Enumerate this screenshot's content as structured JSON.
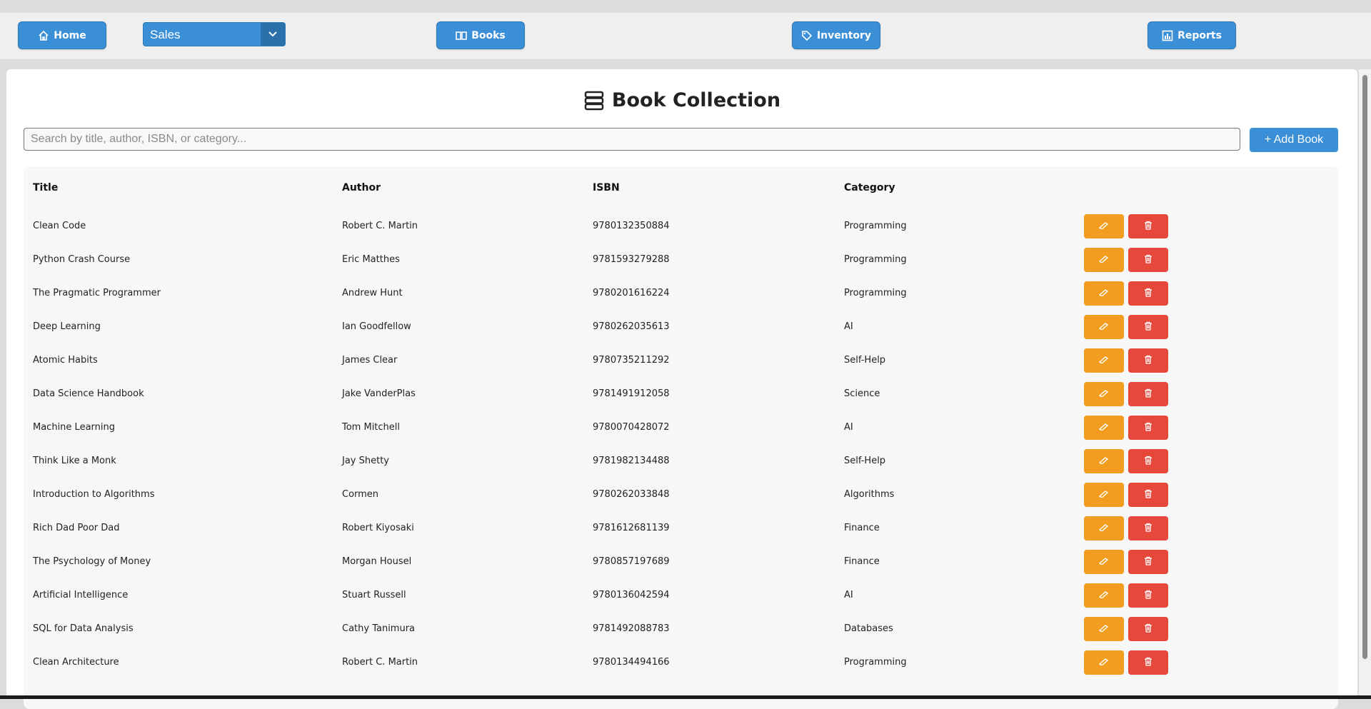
{
  "nav": {
    "home": "Home",
    "books": "Books",
    "inventory": "Inventory",
    "reports": "Reports",
    "sales_select": "Sales"
  },
  "page": {
    "title": "Book Collection",
    "search_placeholder": "Search by title, author, ISBN, or category...",
    "add_button": "+ Add Book"
  },
  "table": {
    "headers": [
      "Title",
      "Author",
      "ISBN",
      "Category"
    ],
    "rows": [
      [
        "Clean Code",
        "Robert C. Martin",
        "9780132350884",
        "Programming"
      ],
      [
        "Python Crash Course",
        "Eric Matthes",
        "9781593279288",
        "Programming"
      ],
      [
        "The Pragmatic Programmer",
        "Andrew Hunt",
        "9780201616224",
        "Programming"
      ],
      [
        "Deep Learning",
        "Ian Goodfellow",
        "9780262035613",
        "AI"
      ],
      [
        "Atomic Habits",
        "James Clear",
        "9780735211292",
        "Self-Help"
      ],
      [
        "Data Science Handbook",
        "Jake VanderPlas",
        "9781491912058",
        "Science"
      ],
      [
        "Machine Learning",
        "Tom Mitchell",
        "9780070428072",
        "AI"
      ],
      [
        "Think Like a Monk",
        "Jay Shetty",
        "9781982134488",
        "Self-Help"
      ],
      [
        "Introduction to Algorithms",
        "Cormen",
        "9780262033848",
        "Algorithms"
      ],
      [
        "Rich Dad Poor Dad",
        "Robert Kiyosaki",
        "9781612681139",
        "Finance"
      ],
      [
        "The Psychology of Money",
        "Morgan Housel",
        "9780857197689",
        "Finance"
      ],
      [
        "Artificial Intelligence",
        "Stuart Russell",
        "9780136042594",
        "AI"
      ],
      [
        "SQL for Data Analysis",
        "Cathy Tanimura",
        "9781492088783",
        "Databases"
      ],
      [
        "Clean Architecture",
        "Robert C. Martin",
        "9780134494166",
        "Programming"
      ]
    ]
  },
  "colors": {
    "primary": "#3a8fd6",
    "edit": "#f29d1f",
    "delete": "#e6483c"
  },
  "icons": {
    "home": "home-icon",
    "books": "book-open-icon",
    "inventory": "tag-icon",
    "reports": "bar-chart-icon",
    "title": "books-stack-icon",
    "edit": "pencil-icon",
    "delete": "trash-icon"
  }
}
